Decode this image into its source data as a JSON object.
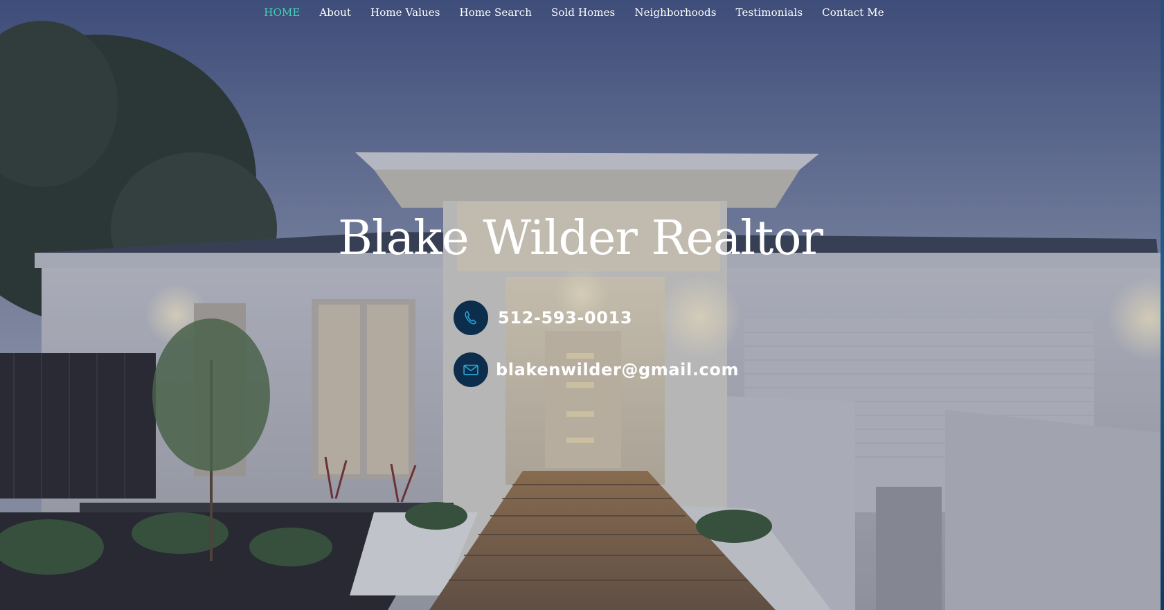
{
  "nav": {
    "items": [
      {
        "label": "HOME",
        "active": true
      },
      {
        "label": "About"
      },
      {
        "label": "Home Values"
      },
      {
        "label": "Home Search"
      },
      {
        "label": "Sold Homes"
      },
      {
        "label": "Neighborhoods"
      },
      {
        "label": "Testimonials"
      },
      {
        "label": "Contact Me"
      }
    ],
    "active_color": "#3fd1b8"
  },
  "hero": {
    "title": "Blake Wilder Realtor",
    "phone": "512-593-0013",
    "email": "blakenwilder@gmail.com",
    "phone_icon": "phone-icon",
    "email_icon": "mail-icon",
    "icon_bg_color": "#0c2e4c",
    "icon_stroke_color": "#2aa3d6"
  }
}
